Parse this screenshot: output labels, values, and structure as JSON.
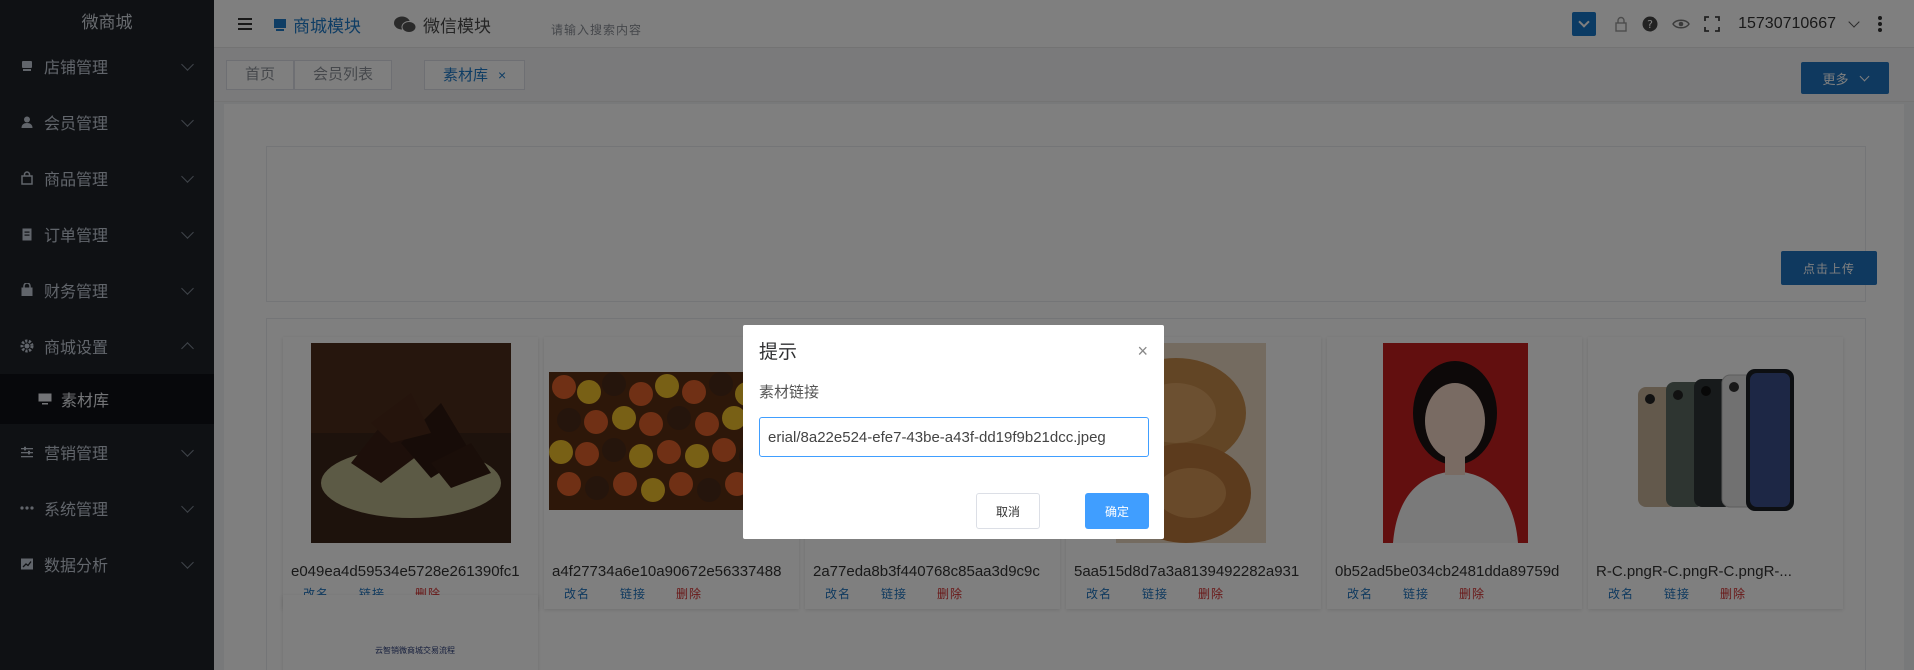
{
  "sidebar": {
    "brand": "微商城",
    "items": [
      {
        "label": "店铺管理",
        "icon": "store-icon"
      },
      {
        "label": "会员管理",
        "icon": "user-icon"
      },
      {
        "label": "商品管理",
        "icon": "bag-icon"
      },
      {
        "label": "订单管理",
        "icon": "order-icon"
      },
      {
        "label": "财务管理",
        "icon": "wallet-icon"
      },
      {
        "label": "商城设置",
        "icon": "gear-icon"
      },
      {
        "label": "营销管理",
        "icon": "sliders-icon"
      },
      {
        "label": "系统管理",
        "icon": "dots-icon"
      },
      {
        "label": "数据分析",
        "icon": "chart-icon"
      }
    ],
    "submenu_active": "素材库"
  },
  "header": {
    "module1": "商城模块",
    "module2": "微信模块",
    "search_placeholder": "请输入搜索内容",
    "username": "15730710667"
  },
  "tabs": {
    "items": [
      "首页",
      "会员列表",
      "素材库"
    ],
    "close_glyph": "×",
    "more_label": "更多"
  },
  "main": {
    "upload_label": "点击上传",
    "items": [
      {
        "name": "e049ea4d59534e5728e261390fc1"
      },
      {
        "name": "a4f27734a6e10a90672e56337488"
      },
      {
        "name": "2a77eda8b3f440768c85aa3d9c9c"
      },
      {
        "name": "5aa515d8d7a3a8139492282a931"
      },
      {
        "name": "0b52ad5be034cb2481dda89759d"
      },
      {
        "name": "R-C.pngR-C.pngR-C.pngR-..."
      }
    ],
    "actions": {
      "rename": "改名",
      "link": "链接",
      "delete": "删除"
    },
    "item7_caption": "云智销微商城交易流程"
  },
  "dialog": {
    "title": "提示",
    "close_glyph": "×",
    "label": "素材链接",
    "input_value": "erial/8a22e524-efe7-43be-a43f-dd19f9b21dcc.jpeg",
    "cancel_label": "取消",
    "ok_label": "确定"
  },
  "colors": {
    "primary": "#1e73be",
    "dialog_primary": "#409eff",
    "sidebar_bg": "#1f2329",
    "danger": "#d32f2f"
  }
}
